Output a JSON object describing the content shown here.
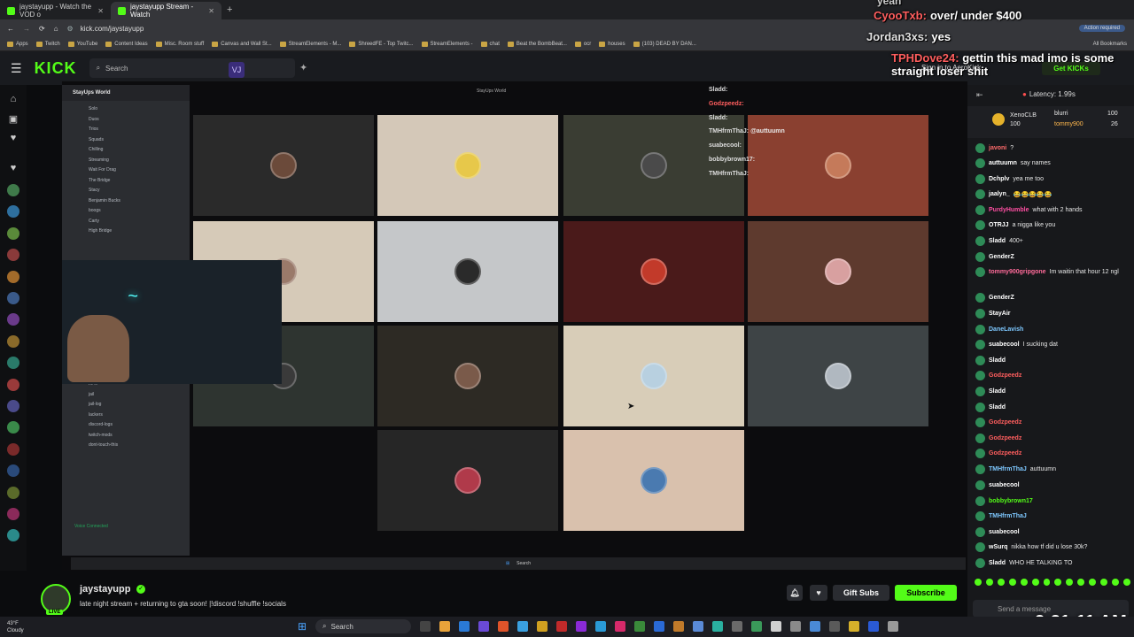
{
  "browser": {
    "tabs": [
      {
        "label": "jaystayupp - Watch the VOD o"
      },
      {
        "label": "jaystayupp Stream - Watch"
      }
    ],
    "url": "kick.com/jaystayupp",
    "action_required": "Action required",
    "bookmarks": [
      "Apps",
      "Twitch",
      "YouTube",
      "Content Ideas",
      "Misc. Room stuff",
      "Canvas and Wall St...",
      "StreamElements - M...",
      "ShreedFE - Top Twitc...",
      "StreamElements -",
      "chat",
      "Beat the BombBeat...",
      "ocr",
      "houses",
      "(103) DEAD BY DAN..."
    ],
    "all_bookmarks": "All Bookmarks"
  },
  "kick": {
    "logo": "KICK",
    "search_placeholder": "Search",
    "sign_in": "Sign in to AeroKick",
    "get_kicks": "Get KICKs",
    "kicks_count": "0"
  },
  "overlay_chat": [
    {
      "user": "",
      "message": "yeah"
    },
    {
      "user": "CyooTxb:",
      "message": "over/ under $400"
    },
    {
      "user": "Jordan3xs:",
      "message": "yes"
    },
    {
      "user": "TPHDove24:",
      "message": "gettin this mad imo is some straight loser shit"
    }
  ],
  "stream_chat_overlay": [
    {
      "user": "Sladd:"
    },
    {
      "user": "Godzpeedz:"
    },
    {
      "user": "Sladd:"
    },
    {
      "user": "TMHfrmThaJ:",
      "message": "@auttuumn"
    },
    {
      "user": "suabecool:"
    },
    {
      "user": "bobbybrown17:"
    },
    {
      "user": "TMHfrmThaJ:"
    }
  ],
  "discord": {
    "server": "StayUps World",
    "channels": [
      "Solo",
      "Duos",
      "Trios",
      "Squads",
      "Chilling",
      "Streaming",
      "Wait For Drag",
      "The Bridge",
      "Stacy"
    ],
    "members": [
      "Benjamin Bucks",
      "boogs",
      "Carty",
      "High Bridge"
    ],
    "lower_channels": [
      "Join to Create",
      "AFK",
      "jail",
      "jail-log",
      "lackers",
      "discord-logs",
      "twitch-mods",
      "dont-touch-this"
    ],
    "voice_connected": "Voice Connected",
    "watermark": "StayUps World"
  },
  "chat": {
    "latency_label": "Latency: 1.99s",
    "top_supporters": [
      {
        "name": "XenoCLB",
        "amount": "100"
      },
      {
        "name": "blurri",
        "amount": "100"
      },
      {
        "name": "tommy900",
        "amount": "26"
      }
    ],
    "messages": [
      {
        "user": "javoni",
        "message": "?",
        "color": "#ff6b6b"
      },
      {
        "user": "auttuumn",
        "message": "say names",
        "color": "#ffffff"
      },
      {
        "user": "Dchplv",
        "message": "yea me too",
        "color": "#ffffff"
      },
      {
        "user": "jaalyn_",
        "message": "😂😂😂😂😂",
        "color": "#ffffff"
      },
      {
        "user": "PurdyHumble",
        "message": "what with 2 hands",
        "color": "#ff4fa3"
      },
      {
        "user": "OTRJJ",
        "message": "a nigga like you",
        "color": "#ffffff"
      },
      {
        "user": "Sladd",
        "message": "400+",
        "color": "#ffffff"
      },
      {
        "user": "GenderZ",
        "message": "",
        "color": "#ffffff"
      },
      {
        "user": "tommy900gripgone",
        "message": "Im waitin that hour 12 ngl",
        "color": "#ff6b9a"
      },
      {
        "user": "GenderZ",
        "message": "",
        "color": "#ffffff"
      },
      {
        "user": "StayAir",
        "message": "",
        "color": "#ffffff"
      },
      {
        "user": "DaneLavish",
        "message": "",
        "color": "#7ec8ff"
      },
      {
        "user": "suabecool",
        "message": "I sucking dat",
        "color": "#ffffff"
      },
      {
        "user": "Sladd",
        "message": "",
        "color": "#ffffff"
      },
      {
        "user": "Godzpeedz",
        "message": "",
        "color": "#ff5e5e"
      },
      {
        "user": "Sladd",
        "message": "",
        "color": "#ffffff"
      },
      {
        "user": "Sladd",
        "message": "",
        "color": "#ffffff"
      },
      {
        "user": "Godzpeedz",
        "message": "",
        "color": "#ff5e5e"
      },
      {
        "user": "Godzpeedz",
        "message": "",
        "color": "#ff5e5e"
      },
      {
        "user": "Godzpeedz",
        "message": "",
        "color": "#ff5e5e"
      },
      {
        "user": "TMHfrmThaJ",
        "message": "auttuumn",
        "color": "#7ec8ff"
      },
      {
        "user": "suabecool",
        "message": "",
        "color": "#ffffff"
      },
      {
        "user": "bobbybrown17",
        "message": "",
        "color": "#53fc18"
      },
      {
        "user": "TMHfrmThaJ",
        "message": "",
        "color": "#7ec8ff"
      },
      {
        "user": "suabecool",
        "message": "",
        "color": "#ffffff"
      },
      {
        "user": "wSurq",
        "message": "nikka how tf did u lose 30k?",
        "color": "#ffffff"
      },
      {
        "user": "Sladd",
        "message": "WHO HE TALKING TO",
        "color": "#ffffff"
      }
    ],
    "send_placeholder": "Send a message"
  },
  "streamer": {
    "name": "jaystayupp",
    "title": "late night stream + returning to gta soon! |!discord !shuffle !socials",
    "live": "LIVE",
    "gift_subs": "Gift Subs",
    "subscribe": "Subscribe"
  },
  "clock": "2:21:11 AM",
  "taskbar": {
    "weather_temp": "43°F",
    "weather_desc": "Cloudy",
    "search": "Search"
  },
  "colors": {
    "kick_green": "#53fc18",
    "chat_bg": "#17181b"
  }
}
